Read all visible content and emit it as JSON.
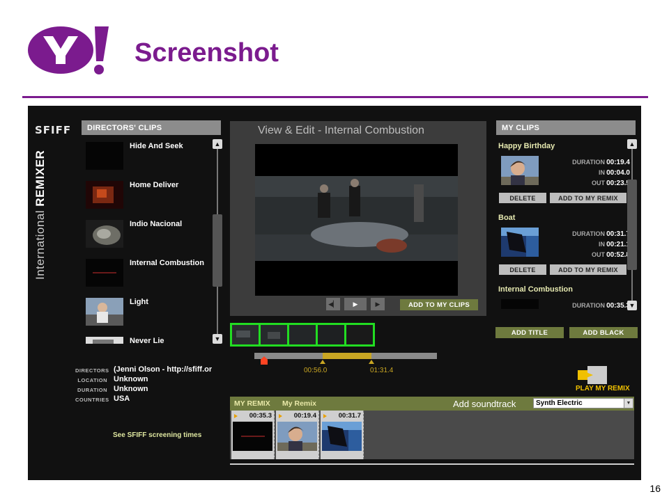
{
  "slide": {
    "title": "Screenshot",
    "page_number": "16"
  },
  "app": {
    "brand": "SFIFF",
    "vertical_title_a": "International ",
    "vertical_title_b": "REMIXER",
    "directors_clips": {
      "header": "DIRECTORS' CLIPS",
      "items": [
        {
          "label": "Hide And Seek"
        },
        {
          "label": "Home Deliver"
        },
        {
          "label": "Indio Nacional"
        },
        {
          "label": "Internal Combustion"
        },
        {
          "label": "Light"
        },
        {
          "label": "Never Lie"
        }
      ]
    },
    "info": {
      "directors_key": "DIRECTORS",
      "directors_val": "(Jenni Olson - http://sfiff.or",
      "location_key": "LOCATION",
      "location_val": "Unknown",
      "duration_key": "DURATION",
      "duration_val": "Unknown",
      "countries_key": "COUNTRIES",
      "countries_val": "USA"
    },
    "screening_link": "See SFIFF screening times",
    "viewer": {
      "title": "View & Edit  - Internal Combustion",
      "add_button": "ADD TO MY CLIPS"
    },
    "scrubber": {
      "in_label": "00:56.0",
      "out_label": "01:31.4"
    },
    "my_clips": {
      "header": "MY CLIPS",
      "duration_key": "DURATION",
      "in_key": "IN",
      "out_key": "OUT",
      "delete_label": "DELETE",
      "add_remix_label": "ADD TO MY REMIX",
      "clips": [
        {
          "name": "Happy Birthday",
          "duration": "00:19.4",
          "in": "00:04.0",
          "out": "00:23.5"
        },
        {
          "name": "Boat",
          "duration": "00:31.7",
          "in": "00:21.1",
          "out": "00:52.8"
        },
        {
          "name": "Internal Combustion",
          "duration": "00:35.3"
        }
      ]
    },
    "add_title": "ADD TITLE",
    "add_black": "ADD BLACK",
    "play_my_remix": "PLAY MY REMIX",
    "remix": {
      "label": "MY REMIX",
      "name": "My Remix",
      "soundtrack_label": "Add soundtrack",
      "soundtrack_value": "Synth Electric",
      "clips": [
        {
          "duration": "00:35.3"
        },
        {
          "duration": "00:19.4"
        },
        {
          "duration": "00:31.7"
        }
      ]
    }
  }
}
